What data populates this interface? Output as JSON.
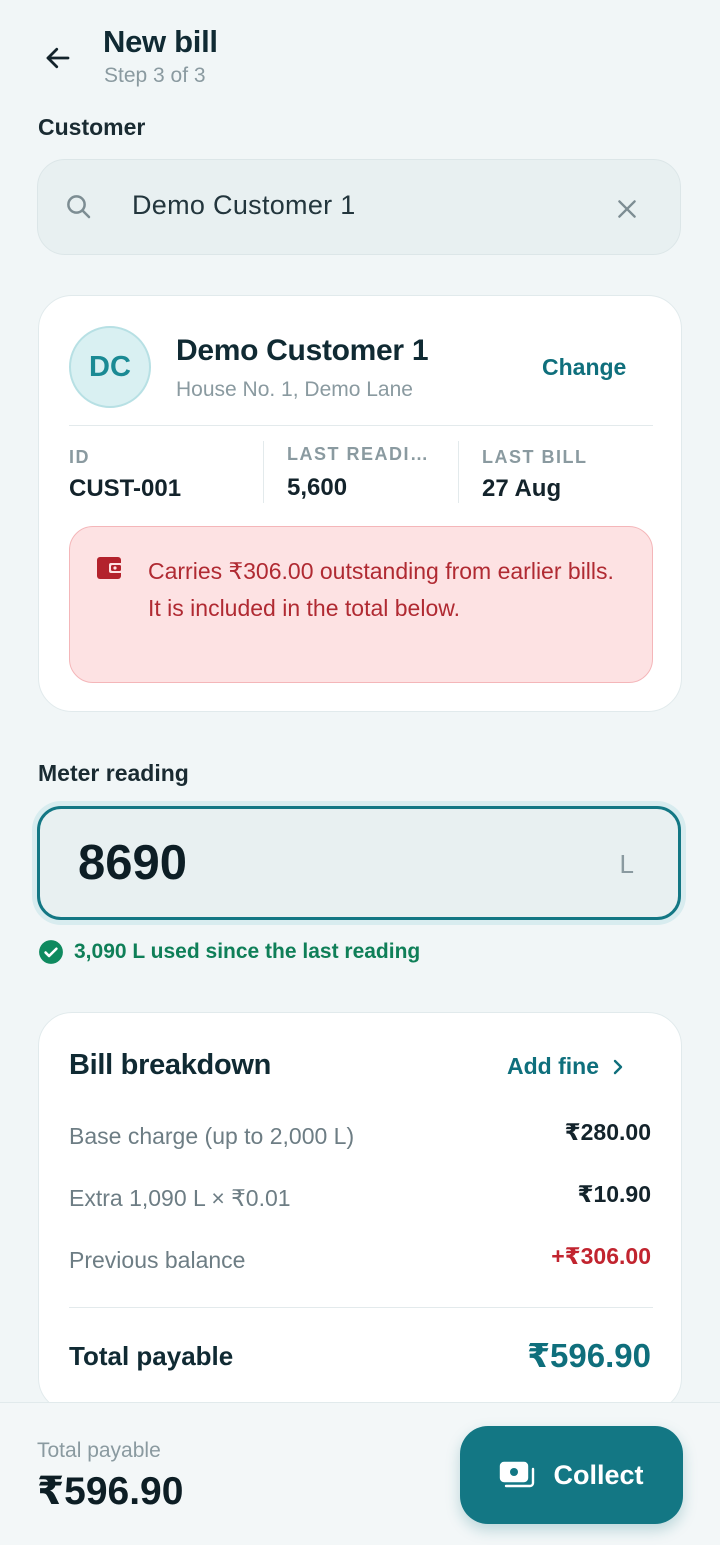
{
  "header": {
    "title": "New bill",
    "subtitle": "Step 3 of 3"
  },
  "customer_section": {
    "label": "Customer",
    "search": {
      "value": "Demo Customer 1",
      "placeholder": ""
    }
  },
  "customer_card": {
    "initials": "DC",
    "name": "Demo Customer 1",
    "address": "House No. 1, Demo Lane",
    "change_label": "Change",
    "stats": [
      {
        "label": "ID",
        "value": "CUST-001"
      },
      {
        "label": "LAST READI…",
        "value": "5,600"
      },
      {
        "label": "LAST BILL",
        "value": "27 Aug"
      }
    ],
    "alert_text": "Carries ₹306.00 outstanding from earlier bills. It is included in the total below."
  },
  "meter": {
    "label": "Meter reading",
    "value": "8690",
    "unit": "L",
    "usage_text": "3,090 L used since the last reading"
  },
  "bill": {
    "title": "Bill breakdown",
    "add_fine_label": "Add fine",
    "rows": [
      {
        "label": "Base charge (up to 2,000 L)",
        "value": "₹280.00"
      },
      {
        "label": "Extra 1,090 L × ₹0.01",
        "value": "₹10.90"
      },
      {
        "label": "Previous balance",
        "value": "+₹306.00"
      }
    ],
    "total_label": "Total payable",
    "total_value": "₹596.90"
  },
  "footer": {
    "total_label": "Total payable",
    "total_value": "₹596.90",
    "collect_label": "Collect"
  },
  "colors": {
    "accent": "#137784",
    "background": "#f1f6f7",
    "alert_bg": "#fde2e3",
    "alert_text": "#b02a32",
    "success": "#0f7f58"
  }
}
